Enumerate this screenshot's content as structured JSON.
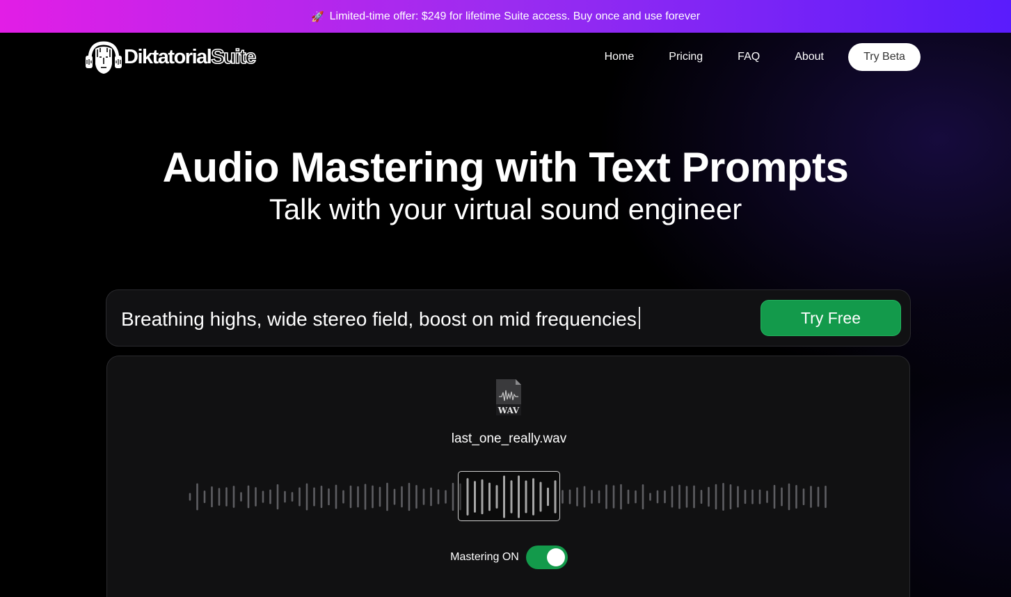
{
  "promo": {
    "icon": "rocket-icon",
    "text": "Limited-time offer: $249 for lifetime Suite access. Buy once and use forever"
  },
  "brand": {
    "name_bold": "Diktatorial",
    "name_outline": "Suite"
  },
  "nav": {
    "items": [
      {
        "label": "Home"
      },
      {
        "label": "Pricing"
      },
      {
        "label": "FAQ"
      },
      {
        "label": "About"
      }
    ],
    "cta_label": "Try Beta"
  },
  "hero": {
    "title": "Audio Mastering with Text Prompts",
    "subtitle": "Talk with your virtual sound engineer"
  },
  "prompt": {
    "value": "Breathing highs, wide stereo field, boost on mid frequencies",
    "button_label": "Try Free"
  },
  "player": {
    "file_icon": "wav-file-icon",
    "file_icon_label": "WAV",
    "file_name": "last_one_really.wav",
    "mastering_label": "Mastering ON",
    "mastering_on": true
  },
  "colors": {
    "promo_gradient_start": "#e21ee6",
    "promo_gradient_end": "#5a1cfc",
    "accent_green": "#139a4b",
    "panel_bg": "#111112"
  }
}
